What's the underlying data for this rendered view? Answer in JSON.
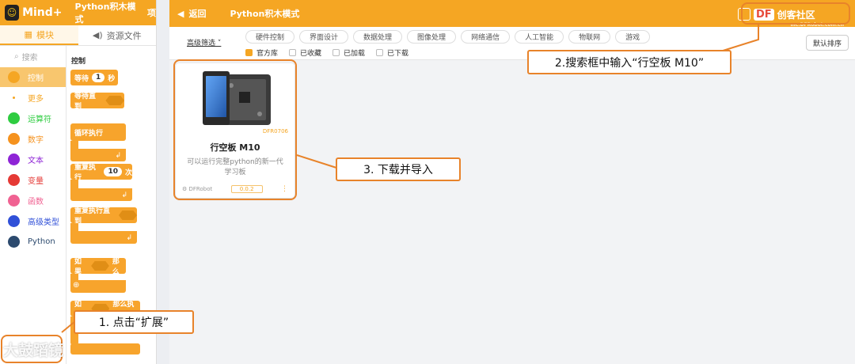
{
  "left_app": {
    "logo_text": "Mind+",
    "mode_title": "Python积木模式",
    "project_label": "项",
    "tabs": [
      {
        "label": "模块",
        "icon": "blocks-icon"
      },
      {
        "label": "资源文件",
        "icon": "speaker-icon"
      }
    ],
    "search_placeholder": "搜索",
    "categories": [
      {
        "label": "控制",
        "color": "#f5a623"
      },
      {
        "label": "更多",
        "color": "#f5a623"
      },
      {
        "label": "运算符",
        "color": "#2ecc40"
      },
      {
        "label": "数字",
        "color": "#f5921e"
      },
      {
        "label": "文本",
        "color": "#8e24d6"
      },
      {
        "label": "变量",
        "color": "#e53935"
      },
      {
        "label": "函数",
        "color": "#f06292"
      },
      {
        "label": "高级类型",
        "color": "#3050d8"
      },
      {
        "label": "Python",
        "color": "#2c4a6e"
      }
    ],
    "blocks_title": "控制",
    "blocks": {
      "wait_label": "等待",
      "wait_value": "1",
      "wait_unit": "秒",
      "wait_until_label": "等待直到",
      "loop_label": "循环执行",
      "repeat_label": "重复执行",
      "repeat_value": "10",
      "repeat_unit": "次",
      "repeat_until_label": "重复执行直到",
      "if_label": "如果",
      "then_label": "那么",
      "if_else_label": "如果",
      "then_exec_label": "那么执行"
    }
  },
  "right_app": {
    "back_label": "返回",
    "mode_title": "Python积木模式",
    "brand_df": "DF",
    "brand_name": "创客社区",
    "brand_site": "mc.DFRobot.com.cn",
    "advanced_filter": "高级筛选",
    "filter_chips": [
      "硬件控制",
      "界面设计",
      "数据处理",
      "图像处理",
      "网络通信",
      "人工智能",
      "物联网",
      "游戏"
    ],
    "source_checks": [
      {
        "label": "官方库",
        "checked": true
      },
      {
        "label": "已收藏",
        "checked": false
      },
      {
        "label": "已加载",
        "checked": false
      },
      {
        "label": "已下载",
        "checked": false
      }
    ],
    "sort_label": "默认排序",
    "card": {
      "sku": "DFR0706",
      "title": "行空板 M10",
      "description": "可以运行完整python的新一代学习板",
      "author": "DFRobot",
      "version": "0.0.2"
    }
  },
  "annotations": {
    "step1": "1. 点击“扩展”",
    "step2": "2.搜索框中输入“行空板 M10”",
    "step3": "3. 下载并导入"
  },
  "watermark": "大鼓蹈镜",
  "colors": {
    "accent": "#f5a623",
    "annotation": "#e8832a"
  }
}
